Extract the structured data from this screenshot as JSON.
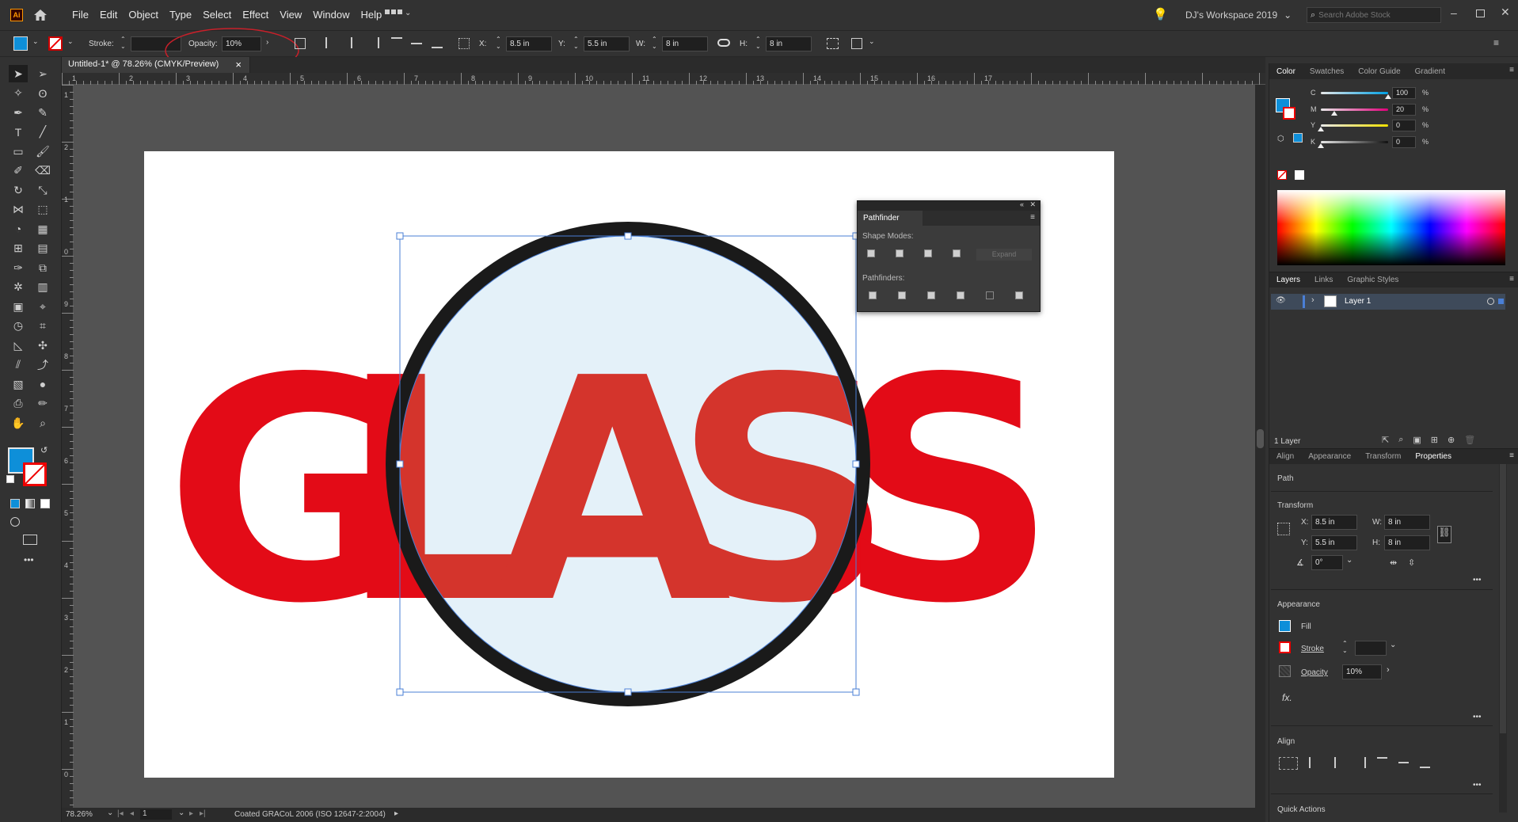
{
  "menubar": {
    "app_icon": "Ai",
    "items": [
      "File",
      "Edit",
      "Object",
      "Type",
      "Select",
      "Effect",
      "View",
      "Window",
      "Help"
    ],
    "workspace": "DJ's Workspace 2019",
    "search_placeholder": "Search Adobe Stock"
  },
  "control_bar": {
    "stroke_label": "Stroke:",
    "opacity_label": "Opacity:",
    "opacity_value": "10%",
    "x_label": "X:",
    "x_value": "8.5 in",
    "y_label": "Y:",
    "y_value": "5.5 in",
    "w_label": "W:",
    "w_value": "8 in",
    "h_label": "H:",
    "h_value": "8 in",
    "annotation_color": "#c8202a"
  },
  "document": {
    "tab_title": "Untitled-1* @ 78.26% (CMYK/Preview)",
    "close_glyph": "×"
  },
  "rulers": {
    "horizontal": [
      "1",
      "2",
      "3",
      "4",
      "5",
      "6",
      "7",
      "8",
      "9",
      "10",
      "11",
      "12",
      "13",
      "14",
      "15",
      "16",
      "17"
    ],
    "vertical": [
      "1",
      "2",
      "1",
      "0",
      "9",
      "8",
      "7",
      "6",
      "5",
      "4",
      "3",
      "2",
      "1",
      "0"
    ]
  },
  "artwork": {
    "text": "GLASS",
    "letters": [
      "G",
      "L",
      "A",
      "S",
      "S"
    ],
    "text_color": "#e30b17",
    "inside_color": "#d4342c",
    "ring_color": "#1a1a1a",
    "lens_color": "#e4f1f9",
    "selection_color": "#4a7fd6"
  },
  "pathfinder": {
    "title": "Pathfinder",
    "shape_modes_label": "Shape Modes:",
    "expand_label": "Expand",
    "pathfinders_label": "Pathfinders:"
  },
  "color_panel": {
    "tabs": [
      "Color",
      "Swatches",
      "Color Guide",
      "Gradient"
    ],
    "channels": [
      {
        "label": "C",
        "value": "100",
        "fraction": 1.0,
        "color": "#00a0e3"
      },
      {
        "label": "M",
        "value": "20",
        "fraction": 0.2,
        "color": "#e0007a"
      },
      {
        "label": "Y",
        "value": "0",
        "fraction": 0.0,
        "color": "#f0e000"
      },
      {
        "label": "K",
        "value": "0",
        "fraction": 0.0,
        "color": "#101010"
      }
    ],
    "percent": "%",
    "fill_color": "#0e8fd9"
  },
  "layers_panel": {
    "tabs": [
      "Layers",
      "Links",
      "Graphic Styles"
    ],
    "layer_name": "Layer 1",
    "footer": "1 Layer"
  },
  "properties_panel": {
    "tabs": [
      "Align",
      "Appearance",
      "Transform",
      "Properties"
    ],
    "path_label": "Path",
    "transform_label": "Transform",
    "x_label": "X:",
    "x_value": "8.5 in",
    "y_label": "Y:",
    "y_value": "5.5 in",
    "w_label": "W:",
    "w_value": "8 in",
    "h_label": "H:",
    "h_value": "8 in",
    "angle_value": "0°",
    "appearance_label": "Appearance",
    "fill_label": "Fill",
    "stroke_label": "Stroke",
    "opacity_label": "Opacity",
    "opacity_value": "10%",
    "fx_label": "fx.",
    "align_label": "Align",
    "quick_actions_label": "Quick Actions",
    "more": "•••"
  },
  "status_bar": {
    "zoom": "78.26%",
    "artboard_number": "1",
    "profile": "Coated GRACoL 2006 (ISO 12647-2:2004)"
  }
}
